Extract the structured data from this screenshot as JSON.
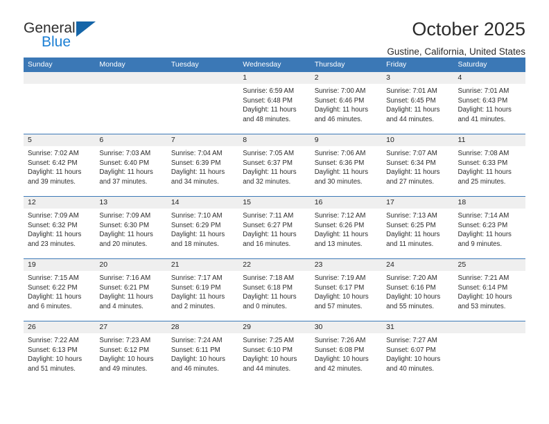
{
  "brand": {
    "name_top": "General",
    "name_bottom": "Blue",
    "triangle_color": "#1565a8",
    "blue_text_color": "#1b7fd4"
  },
  "header": {
    "title": "October 2025",
    "subtitle": "Gustine, California, United States"
  },
  "theme": {
    "header_bar": "#3b78b6",
    "daynum_band": "#efefef",
    "text": "#2c2c2c"
  },
  "weekdays": [
    "Sunday",
    "Monday",
    "Tuesday",
    "Wednesday",
    "Thursday",
    "Friday",
    "Saturday"
  ],
  "weeks": [
    {
      "days": [
        {
          "num": "",
          "lines": [
            "",
            "",
            "",
            ""
          ]
        },
        {
          "num": "",
          "lines": [
            "",
            "",
            "",
            ""
          ]
        },
        {
          "num": "",
          "lines": [
            "",
            "",
            "",
            ""
          ]
        },
        {
          "num": "1",
          "lines": [
            "Sunrise: 6:59 AM",
            "Sunset: 6:48 PM",
            "Daylight: 11 hours",
            "and 48 minutes."
          ]
        },
        {
          "num": "2",
          "lines": [
            "Sunrise: 7:00 AM",
            "Sunset: 6:46 PM",
            "Daylight: 11 hours",
            "and 46 minutes."
          ]
        },
        {
          "num": "3",
          "lines": [
            "Sunrise: 7:01 AM",
            "Sunset: 6:45 PM",
            "Daylight: 11 hours",
            "and 44 minutes."
          ]
        },
        {
          "num": "4",
          "lines": [
            "Sunrise: 7:01 AM",
            "Sunset: 6:43 PM",
            "Daylight: 11 hours",
            "and 41 minutes."
          ]
        }
      ]
    },
    {
      "days": [
        {
          "num": "5",
          "lines": [
            "Sunrise: 7:02 AM",
            "Sunset: 6:42 PM",
            "Daylight: 11 hours",
            "and 39 minutes."
          ]
        },
        {
          "num": "6",
          "lines": [
            "Sunrise: 7:03 AM",
            "Sunset: 6:40 PM",
            "Daylight: 11 hours",
            "and 37 minutes."
          ]
        },
        {
          "num": "7",
          "lines": [
            "Sunrise: 7:04 AM",
            "Sunset: 6:39 PM",
            "Daylight: 11 hours",
            "and 34 minutes."
          ]
        },
        {
          "num": "8",
          "lines": [
            "Sunrise: 7:05 AM",
            "Sunset: 6:37 PM",
            "Daylight: 11 hours",
            "and 32 minutes."
          ]
        },
        {
          "num": "9",
          "lines": [
            "Sunrise: 7:06 AM",
            "Sunset: 6:36 PM",
            "Daylight: 11 hours",
            "and 30 minutes."
          ]
        },
        {
          "num": "10",
          "lines": [
            "Sunrise: 7:07 AM",
            "Sunset: 6:34 PM",
            "Daylight: 11 hours",
            "and 27 minutes."
          ]
        },
        {
          "num": "11",
          "lines": [
            "Sunrise: 7:08 AM",
            "Sunset: 6:33 PM",
            "Daylight: 11 hours",
            "and 25 minutes."
          ]
        }
      ]
    },
    {
      "days": [
        {
          "num": "12",
          "lines": [
            "Sunrise: 7:09 AM",
            "Sunset: 6:32 PM",
            "Daylight: 11 hours",
            "and 23 minutes."
          ]
        },
        {
          "num": "13",
          "lines": [
            "Sunrise: 7:09 AM",
            "Sunset: 6:30 PM",
            "Daylight: 11 hours",
            "and 20 minutes."
          ]
        },
        {
          "num": "14",
          "lines": [
            "Sunrise: 7:10 AM",
            "Sunset: 6:29 PM",
            "Daylight: 11 hours",
            "and 18 minutes."
          ]
        },
        {
          "num": "15",
          "lines": [
            "Sunrise: 7:11 AM",
            "Sunset: 6:27 PM",
            "Daylight: 11 hours",
            "and 16 minutes."
          ]
        },
        {
          "num": "16",
          "lines": [
            "Sunrise: 7:12 AM",
            "Sunset: 6:26 PM",
            "Daylight: 11 hours",
            "and 13 minutes."
          ]
        },
        {
          "num": "17",
          "lines": [
            "Sunrise: 7:13 AM",
            "Sunset: 6:25 PM",
            "Daylight: 11 hours",
            "and 11 minutes."
          ]
        },
        {
          "num": "18",
          "lines": [
            "Sunrise: 7:14 AM",
            "Sunset: 6:23 PM",
            "Daylight: 11 hours",
            "and 9 minutes."
          ]
        }
      ]
    },
    {
      "days": [
        {
          "num": "19",
          "lines": [
            "Sunrise: 7:15 AM",
            "Sunset: 6:22 PM",
            "Daylight: 11 hours",
            "and 6 minutes."
          ]
        },
        {
          "num": "20",
          "lines": [
            "Sunrise: 7:16 AM",
            "Sunset: 6:21 PM",
            "Daylight: 11 hours",
            "and 4 minutes."
          ]
        },
        {
          "num": "21",
          "lines": [
            "Sunrise: 7:17 AM",
            "Sunset: 6:19 PM",
            "Daylight: 11 hours",
            "and 2 minutes."
          ]
        },
        {
          "num": "22",
          "lines": [
            "Sunrise: 7:18 AM",
            "Sunset: 6:18 PM",
            "Daylight: 11 hours",
            "and 0 minutes."
          ]
        },
        {
          "num": "23",
          "lines": [
            "Sunrise: 7:19 AM",
            "Sunset: 6:17 PM",
            "Daylight: 10 hours",
            "and 57 minutes."
          ]
        },
        {
          "num": "24",
          "lines": [
            "Sunrise: 7:20 AM",
            "Sunset: 6:16 PM",
            "Daylight: 10 hours",
            "and 55 minutes."
          ]
        },
        {
          "num": "25",
          "lines": [
            "Sunrise: 7:21 AM",
            "Sunset: 6:14 PM",
            "Daylight: 10 hours",
            "and 53 minutes."
          ]
        }
      ]
    },
    {
      "days": [
        {
          "num": "26",
          "lines": [
            "Sunrise: 7:22 AM",
            "Sunset: 6:13 PM",
            "Daylight: 10 hours",
            "and 51 minutes."
          ]
        },
        {
          "num": "27",
          "lines": [
            "Sunrise: 7:23 AM",
            "Sunset: 6:12 PM",
            "Daylight: 10 hours",
            "and 49 minutes."
          ]
        },
        {
          "num": "28",
          "lines": [
            "Sunrise: 7:24 AM",
            "Sunset: 6:11 PM",
            "Daylight: 10 hours",
            "and 46 minutes."
          ]
        },
        {
          "num": "29",
          "lines": [
            "Sunrise: 7:25 AM",
            "Sunset: 6:10 PM",
            "Daylight: 10 hours",
            "and 44 minutes."
          ]
        },
        {
          "num": "30",
          "lines": [
            "Sunrise: 7:26 AM",
            "Sunset: 6:08 PM",
            "Daylight: 10 hours",
            "and 42 minutes."
          ]
        },
        {
          "num": "31",
          "lines": [
            "Sunrise: 7:27 AM",
            "Sunset: 6:07 PM",
            "Daylight: 10 hours",
            "and 40 minutes."
          ]
        },
        {
          "num": "",
          "lines": [
            "",
            "",
            "",
            ""
          ]
        }
      ]
    }
  ]
}
